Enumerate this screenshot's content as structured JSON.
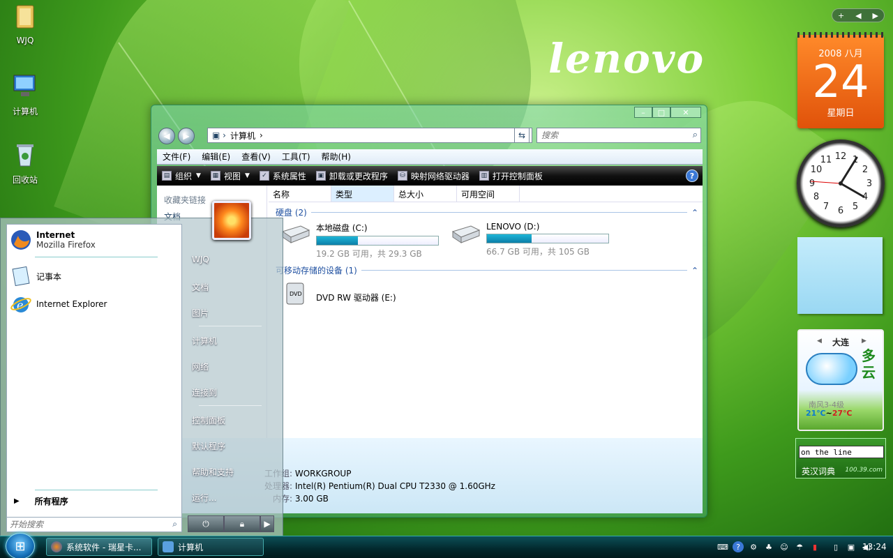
{
  "brand": "lenovo",
  "desktop_icons": [
    {
      "label": "WJQ",
      "icon": "user-folder-icon"
    },
    {
      "label": "计算机",
      "icon": "computer-icon"
    },
    {
      "label": "回收站",
      "icon": "recycle-bin-icon"
    }
  ],
  "explorer": {
    "address": "计算机",
    "search_placeholder": "搜索",
    "menu": [
      "文件(F)",
      "编辑(E)",
      "查看(V)",
      "工具(T)",
      "帮助(H)"
    ],
    "commands": [
      "组织",
      "视图",
      "系统属性",
      "卸载或更改程序",
      "映射网络驱动器",
      "打开控制面板"
    ],
    "nav_pane": {
      "favorites": "收藏夹链接",
      "documents": "文档"
    },
    "columns": [
      "名称",
      "类型",
      "总大小",
      "可用空间"
    ],
    "groups": [
      {
        "title": "硬盘 (2)"
      },
      {
        "title": "可移动存储的设备 (1)"
      }
    ],
    "drives": [
      {
        "name": "本地磁盘 (C:)",
        "free": "19.2 GB 可用，共 29.3 GB",
        "used_fraction": 0.34
      },
      {
        "name": "LENOVO (D:)",
        "free": "66.7 GB 可用，共 105 GB",
        "used_fraction": 0.37
      },
      {
        "name": "DVD RW 驱动器 (E:)"
      }
    ],
    "details": {
      "workgroup_label": "工作组:",
      "workgroup": "WORKGROUP",
      "cpu_label": "处理器:",
      "cpu": "Intel(R) Pentium(R) Dual  CPU  T2330  @ 1.60GHz",
      "ram_label": "内存:",
      "ram": "3.00 GB"
    }
  },
  "start_menu": {
    "pinned": [
      {
        "title": "Internet",
        "subtitle": "Mozilla Firefox",
        "icon": "firefox-icon"
      },
      {
        "title": "记事本",
        "icon": "notepad-icon"
      },
      {
        "title": "Internet Explorer",
        "icon": "ie-icon"
      }
    ],
    "all_programs": "所有程序",
    "search_placeholder": "开始搜索",
    "right_items": [
      "WJQ",
      "文档",
      "图片",
      "计算机",
      "网络",
      "连接到",
      "控制面板",
      "默认程序",
      "帮助和支持",
      "运行..."
    ]
  },
  "taskbar": {
    "buttons": [
      "系统软件 - 瑞星卡...",
      "计算机"
    ],
    "clock": "13:24"
  },
  "gadgets": {
    "calendar": {
      "year_month": "2008 八月",
      "day": "24",
      "weekday": "星期日"
    },
    "weather": {
      "city": "大连",
      "condition": "多云",
      "wind": "南风3-4级",
      "temp_low": "21℃",
      "temp_sep": "~",
      "temp_high": "27℃"
    },
    "dictionary": {
      "input_value": "on the line",
      "label": "英汉词典",
      "version": "100.39.com"
    }
  }
}
